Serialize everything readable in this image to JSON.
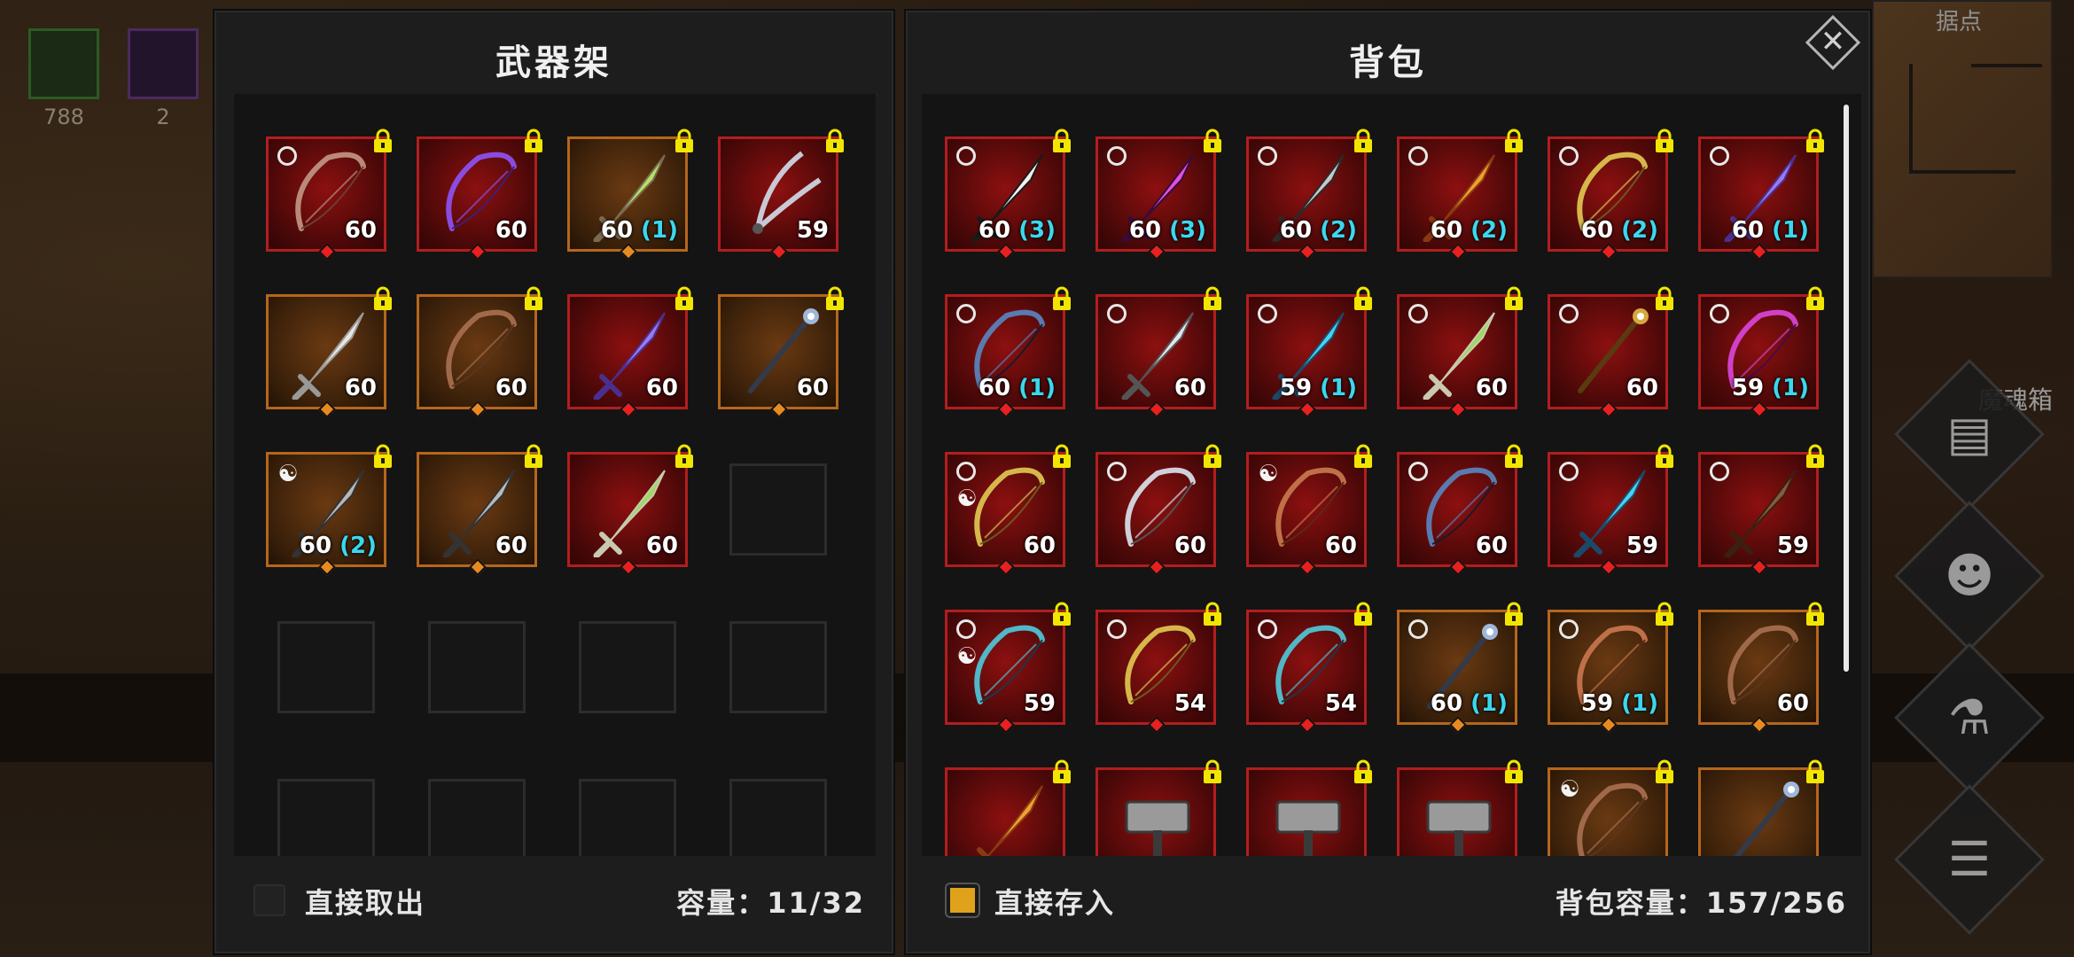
{
  "hud": {
    "resources": [
      {
        "icon": "green-relic-icon",
        "count": "788",
        "color": "#2d5a22"
      },
      {
        "icon": "purple-relic-icon",
        "count": "2",
        "color": "#4c2a5e"
      }
    ],
    "minimap_title": "据点",
    "side_label": "魔魂箱"
  },
  "rack": {
    "title": "武器架",
    "take_out_label": "直接取出",
    "take_out_checked": false,
    "capacity": "容量：11/32",
    "items": [
      {
        "weapon": "crossbow",
        "rarity": "red",
        "level": "60",
        "bonus": "",
        "circle": true,
        "yinyang": false
      },
      {
        "weapon": "purple-bow",
        "rarity": "red",
        "level": "60",
        "bonus": "",
        "circle": false,
        "yinyang": false
      },
      {
        "weapon": "green-dagger",
        "rarity": "orange",
        "level": "60",
        "bonus": "(1)",
        "circle": false,
        "yinyang": false
      },
      {
        "weapon": "claw-blade",
        "rarity": "red",
        "level": "59",
        "bonus": "",
        "circle": false,
        "yinyang": false
      },
      {
        "weapon": "bone-spike",
        "rarity": "orange",
        "level": "60",
        "bonus": "",
        "circle": false,
        "yinyang": false
      },
      {
        "weapon": "wooden-bow",
        "rarity": "orange",
        "level": "60",
        "bonus": "",
        "circle": false,
        "yinyang": false
      },
      {
        "weapon": "violet-dagger",
        "rarity": "red",
        "level": "60",
        "bonus": "",
        "circle": false,
        "yinyang": false
      },
      {
        "weapon": "orb-staff",
        "rarity": "orange",
        "level": "60",
        "bonus": "",
        "circle": false,
        "yinyang": false
      },
      {
        "weapon": "short-sword",
        "rarity": "orange",
        "level": "60",
        "bonus": "(2)",
        "circle": false,
        "yinyang": true
      },
      {
        "weapon": "short-sword",
        "rarity": "orange",
        "level": "60",
        "bonus": "",
        "circle": false,
        "yinyang": false
      },
      {
        "weapon": "skull-dagger",
        "rarity": "red",
        "level": "60",
        "bonus": "",
        "circle": false,
        "yinyang": false
      }
    ]
  },
  "bag": {
    "title": "背包",
    "store_label": "直接存入",
    "store_checked": true,
    "capacity": "背包容量：157/256",
    "items": [
      {
        "weapon": "scimitar",
        "rarity": "red",
        "level": "60",
        "bonus": "(3)",
        "circle": true,
        "yinyang": false
      },
      {
        "weapon": "pink-scimitar",
        "rarity": "red",
        "level": "60",
        "bonus": "(3)",
        "circle": true,
        "yinyang": false
      },
      {
        "weapon": "long-sword",
        "rarity": "red",
        "level": "60",
        "bonus": "(2)",
        "circle": true,
        "yinyang": false
      },
      {
        "weapon": "flame-dagger",
        "rarity": "red",
        "level": "60",
        "bonus": "(2)",
        "circle": true,
        "yinyang": false
      },
      {
        "weapon": "golden-bow",
        "rarity": "red",
        "level": "60",
        "bonus": "(2)",
        "circle": true,
        "yinyang": false
      },
      {
        "weapon": "violet-dagger",
        "rarity": "red",
        "level": "60",
        "bonus": "(1)",
        "circle": true,
        "yinyang": false
      },
      {
        "weapon": "dark-bow",
        "rarity": "red",
        "level": "60",
        "bonus": "(1)",
        "circle": true,
        "yinyang": false
      },
      {
        "weapon": "thin-sword",
        "rarity": "red",
        "level": "60",
        "bonus": "",
        "circle": true,
        "yinyang": false
      },
      {
        "weapon": "spectral-sword",
        "rarity": "red",
        "level": "59",
        "bonus": "(1)",
        "circle": true,
        "yinyang": false
      },
      {
        "weapon": "skull-dagger",
        "rarity": "red",
        "level": "60",
        "bonus": "",
        "circle": true,
        "yinyang": false
      },
      {
        "weapon": "golden-spear",
        "rarity": "red",
        "level": "60",
        "bonus": "",
        "circle": true,
        "yinyang": false
      },
      {
        "weapon": "magenta-bow",
        "rarity": "red",
        "level": "59",
        "bonus": "(1)",
        "circle": true,
        "yinyang": false
      },
      {
        "weapon": "golden-bow",
        "rarity": "red",
        "level": "60",
        "bonus": "",
        "circle": true,
        "yinyang": true
      },
      {
        "weapon": "silver-bow",
        "rarity": "red",
        "level": "60",
        "bonus": "",
        "circle": true,
        "yinyang": false
      },
      {
        "weapon": "copper-bow",
        "rarity": "red",
        "level": "60",
        "bonus": "",
        "circle": false,
        "yinyang": true
      },
      {
        "weapon": "dark-bow",
        "rarity": "red",
        "level": "60",
        "bonus": "",
        "circle": true,
        "yinyang": false
      },
      {
        "weapon": "spectral-sword",
        "rarity": "red",
        "level": "59",
        "bonus": "",
        "circle": true,
        "yinyang": false
      },
      {
        "weapon": "jagged-blade",
        "rarity": "red",
        "level": "59",
        "bonus": "",
        "circle": true,
        "yinyang": false
      },
      {
        "weapon": "teal-bow",
        "rarity": "red",
        "level": "59",
        "bonus": "",
        "circle": true,
        "yinyang": true
      },
      {
        "weapon": "golden-bow",
        "rarity": "red",
        "level": "54",
        "bonus": "",
        "circle": true,
        "yinyang": false
      },
      {
        "weapon": "teal-bow",
        "rarity": "red",
        "level": "54",
        "bonus": "",
        "circle": true,
        "yinyang": false
      },
      {
        "weapon": "orb-staff",
        "rarity": "orange",
        "level": "60",
        "bonus": "(1)",
        "circle": true,
        "yinyang": false
      },
      {
        "weapon": "copper-bow",
        "rarity": "orange",
        "level": "59",
        "bonus": "(1)",
        "circle": true,
        "yinyang": false
      },
      {
        "weapon": "wooden-bow",
        "rarity": "orange",
        "level": "60",
        "bonus": "",
        "circle": false,
        "yinyang": false
      },
      {
        "weapon": "flame-dagger",
        "rarity": "red",
        "level": "",
        "bonus": "",
        "circle": false,
        "yinyang": false
      },
      {
        "weapon": "war-hammer",
        "rarity": "red",
        "level": "",
        "bonus": "",
        "circle": false,
        "yinyang": false
      },
      {
        "weapon": "war-hammer",
        "rarity": "red",
        "level": "",
        "bonus": "",
        "circle": false,
        "yinyang": false
      },
      {
        "weapon": "war-hammer",
        "rarity": "red",
        "level": "",
        "bonus": "",
        "circle": false,
        "yinyang": false
      },
      {
        "weapon": "wooden-bow",
        "rarity": "orange",
        "level": "",
        "bonus": "",
        "circle": false,
        "yinyang": true
      },
      {
        "weapon": "orb-staff",
        "rarity": "orange",
        "level": "",
        "bonus": "",
        "circle": false,
        "yinyang": false
      }
    ]
  },
  "icons": {
    "close": "close-icon",
    "lock": "lock-icon",
    "yinyang": "yinyang-icon",
    "side_buttons": [
      "mailbox-icon",
      "friends-icon",
      "potion-icon",
      "menu-list-icon"
    ]
  },
  "colors": {
    "red_rarity": "#b21e1e",
    "orange_rarity": "#b5661c",
    "bonus": "#3ad8ee",
    "lock": "#f2e600",
    "checkbox_on": "#e0a21a"
  }
}
